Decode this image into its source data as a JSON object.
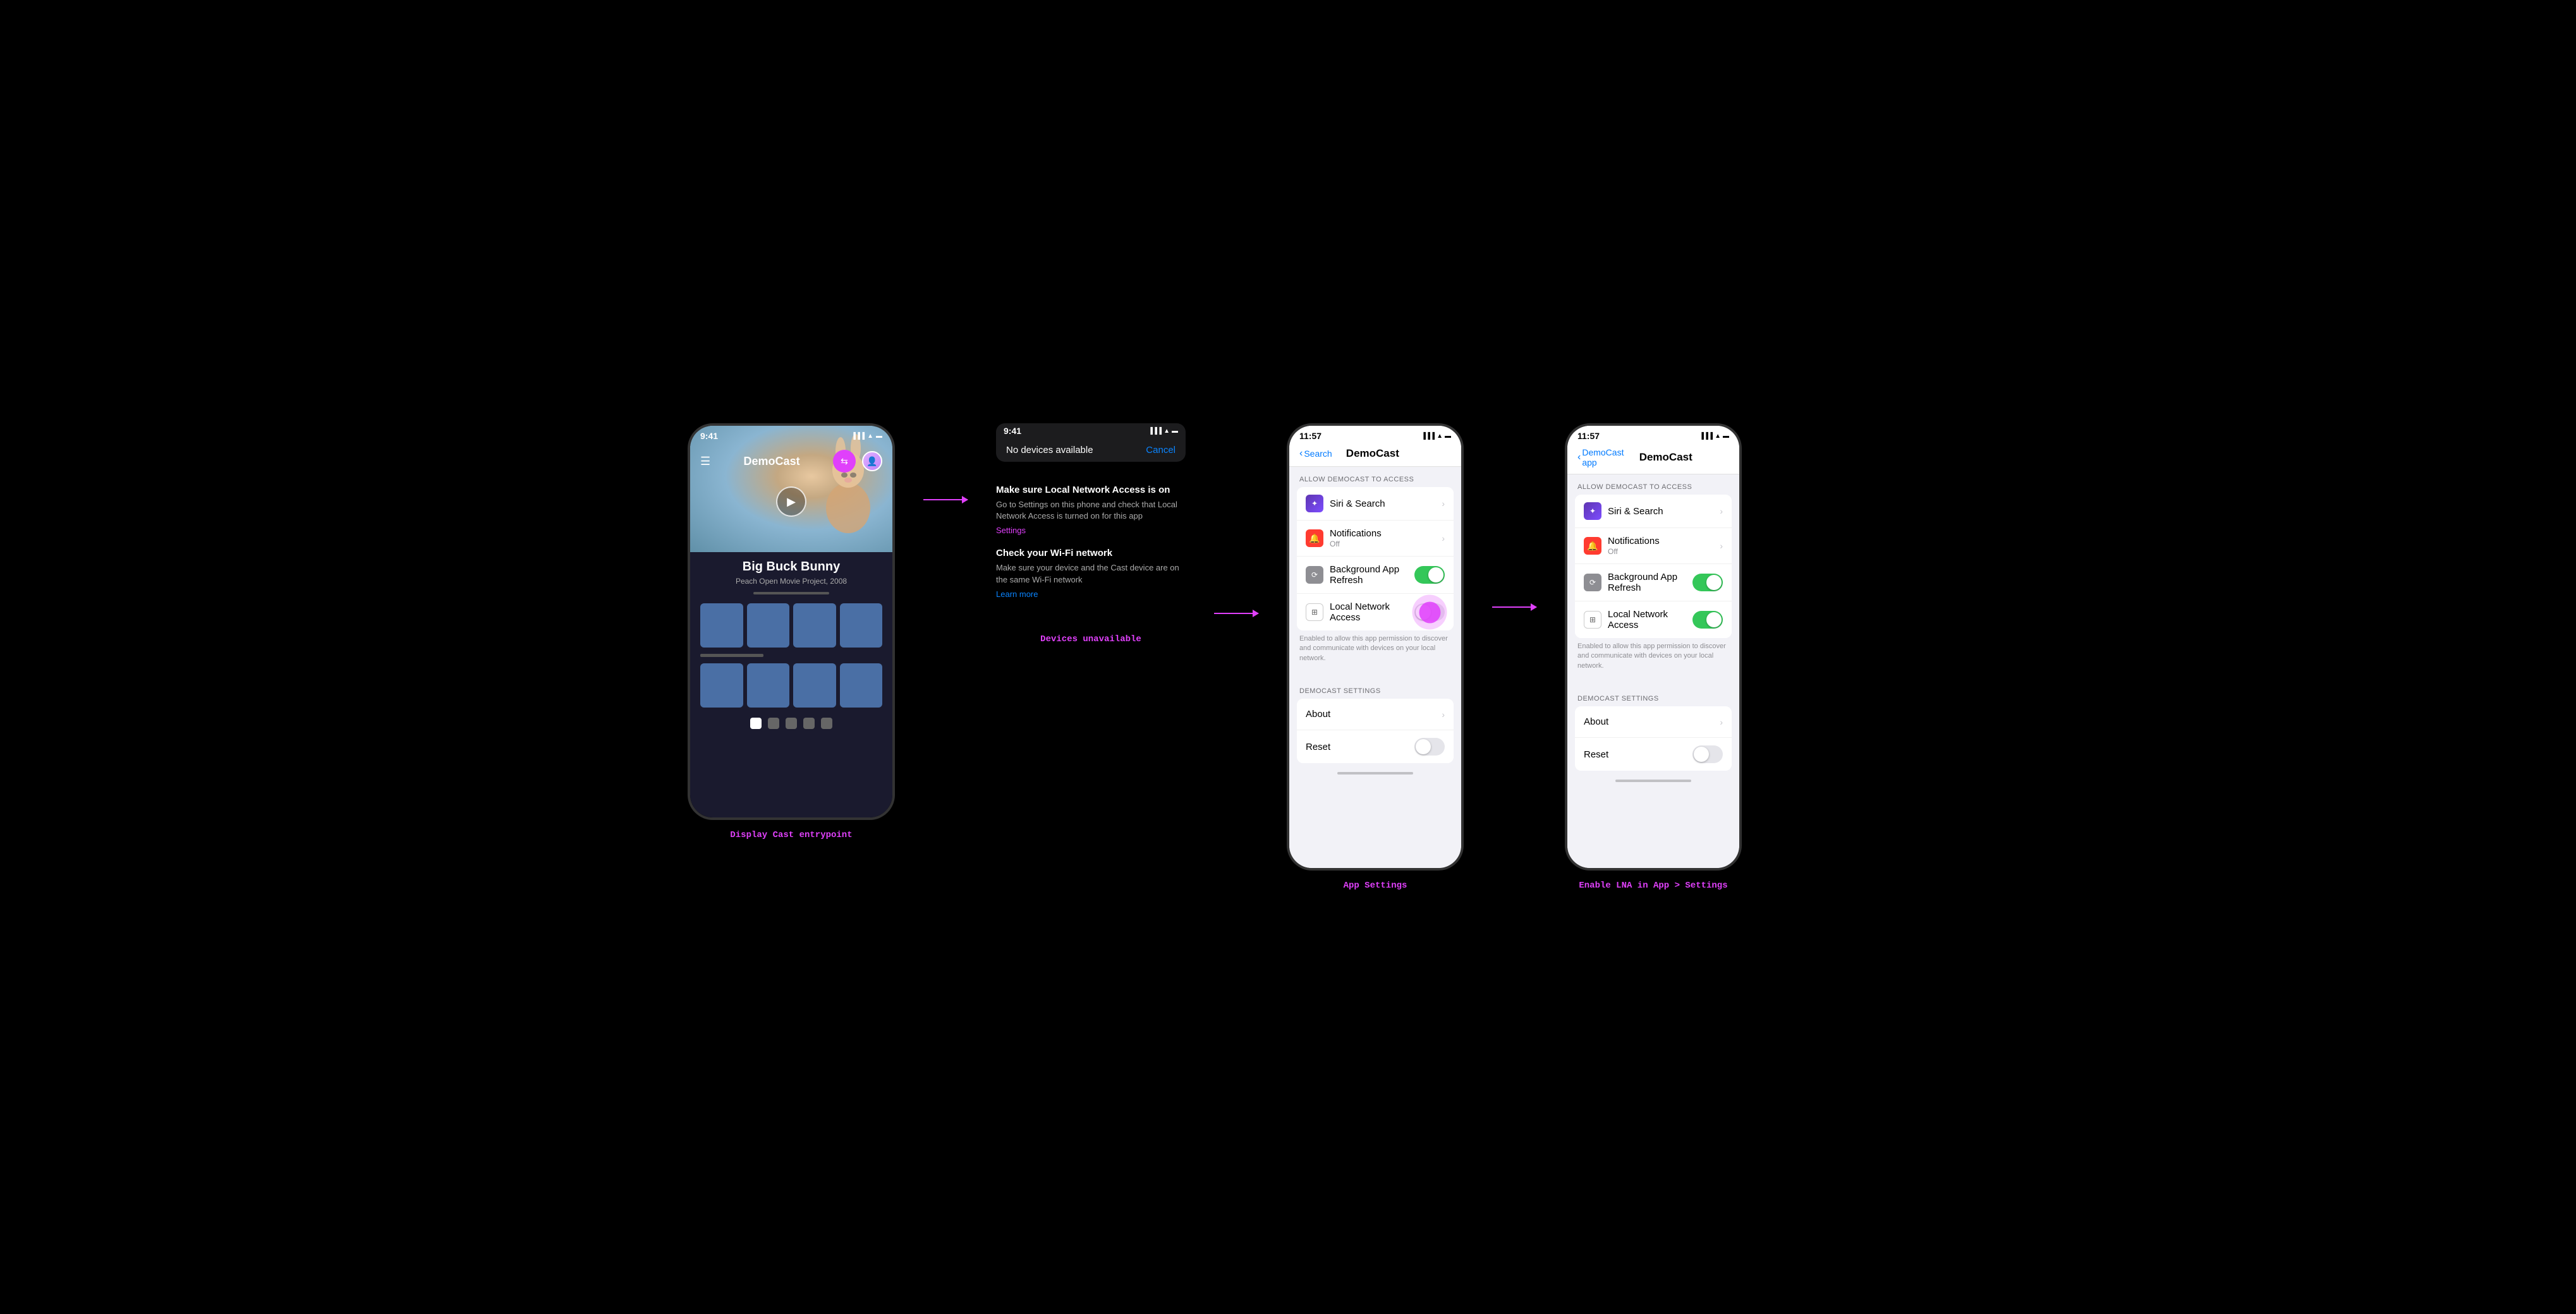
{
  "phone1": {
    "time": "9:41",
    "signal": "▐▐▐",
    "wifi": "WiFi",
    "battery": "🔋",
    "appName": "DemoCast",
    "movieTitle": "Big Buck Bunny",
    "movieSubtitle": "Peach Open Movie Project, 2008",
    "label": "Display Cast entrypoint"
  },
  "popup": {
    "time": "9:41",
    "title": "No devices available",
    "cancel": "Cancel"
  },
  "troubleshoot": {
    "title1": "Make sure Local Network Access is on",
    "body1": "Go to Settings on this phone and check that Local Network Access is turned on for this app",
    "link1": "Settings",
    "title2": "Check your Wi-Fi network",
    "body2": "Make sure your device and the Cast device are on the same Wi-Fi network",
    "link2": "Learn more",
    "label": "Devices unavailable"
  },
  "appSettings": {
    "time": "11:57",
    "backText": "Search",
    "pageTitle": "DemoCast",
    "sectionHeader": "ALLOW DEMOCAST TO ACCESS",
    "items": [
      {
        "icon": "siri",
        "label": "Siri & Search",
        "sublabel": "",
        "hasChevron": true,
        "hasToggle": false
      },
      {
        "icon": "notifications",
        "label": "Notifications",
        "sublabel": "Off",
        "hasChevron": true,
        "hasToggle": false
      },
      {
        "icon": "refresh",
        "label": "Background App Refresh",
        "sublabel": "",
        "hasChevron": false,
        "hasToggle": true,
        "toggleOn": true
      },
      {
        "icon": "network",
        "label": "Local Network Access",
        "sublabel": "",
        "hasChevron": false,
        "hasToggle": true,
        "toggleOn": false
      }
    ],
    "lnaNote": "Enabled to allow this app permission to discover and communicate with devices on your local network.",
    "settingsSection": "DEMOCAST SETTINGS",
    "settingsItems": [
      {
        "label": "About",
        "hasChevron": true,
        "hasToggle": false
      },
      {
        "label": "Reset",
        "hasChevron": false,
        "hasToggle": true,
        "toggleOn": false
      }
    ],
    "label": "App Settings",
    "showPinkDot": true
  },
  "enableLNA": {
    "time": "11:57",
    "backText": "DemoCast app",
    "pageTitle": "DemoCast",
    "sectionHeader": "ALLOW DEMOCAST TO ACCESS",
    "items": [
      {
        "icon": "siri",
        "label": "Siri & Search",
        "sublabel": "",
        "hasChevron": true,
        "hasToggle": false
      },
      {
        "icon": "notifications",
        "label": "Notifications",
        "sublabel": "Off",
        "hasChevron": true,
        "hasToggle": false
      },
      {
        "icon": "refresh",
        "label": "Background App Refresh",
        "sublabel": "",
        "hasChevron": false,
        "hasToggle": true,
        "toggleOn": true
      },
      {
        "icon": "network",
        "label": "Local Network Access",
        "sublabel": "",
        "hasChevron": false,
        "hasToggle": true,
        "toggleOn": true
      }
    ],
    "lnaNote": "Enabled to allow this app permission to discover and communicate with devices on your local network.",
    "settingsSection": "DEMOCAST SETTINGS",
    "settingsItems": [
      {
        "label": "About",
        "hasChevron": true,
        "hasToggle": false
      },
      {
        "label": "Reset",
        "hasChevron": false,
        "hasToggle": true,
        "toggleOn": false
      }
    ],
    "label": "Enable LNA in App > Settings",
    "showPinkDot": false
  },
  "arrows": {
    "color": "#e040fb"
  }
}
